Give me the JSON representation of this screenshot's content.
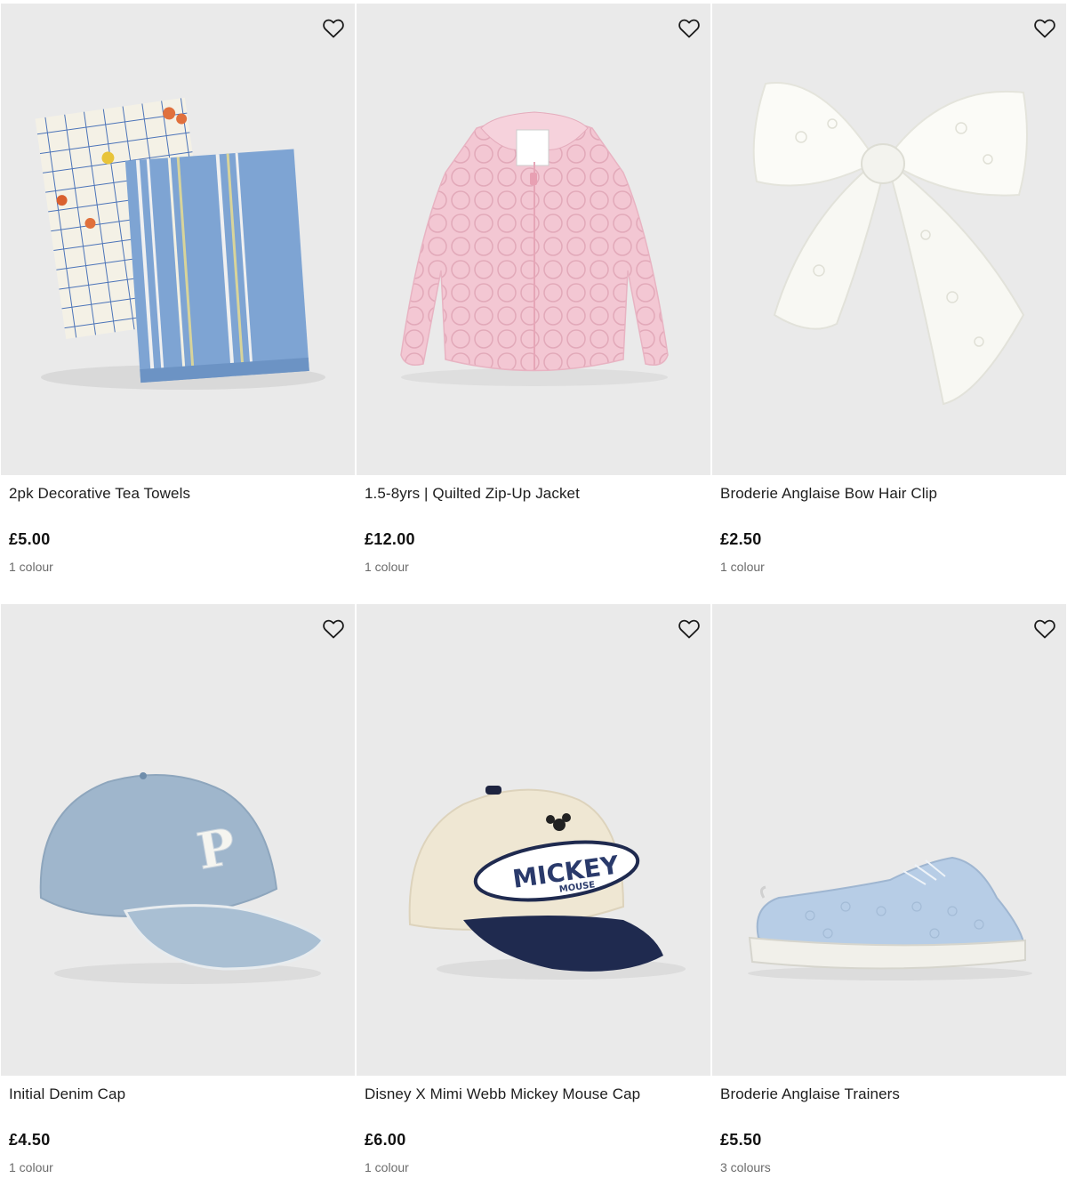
{
  "products": [
    {
      "name": "2pk Decorative Tea Towels",
      "price": "£5.00",
      "colours": "1 colour",
      "image": "tea-towels"
    },
    {
      "name": "1.5-8yrs | Quilted Zip-Up Jacket",
      "price": "£12.00",
      "colours": "1 colour",
      "image": "quilted-jacket"
    },
    {
      "name": "Broderie Anglaise Bow Hair Clip",
      "price": "£2.50",
      "colours": "1 colour",
      "image": "bow-hair-clip"
    },
    {
      "name": "Initial Denim Cap",
      "price": "£4.50",
      "colours": "1 colour",
      "image": "denim-cap"
    },
    {
      "name": "Disney X Mimi Webb Mickey Mouse Cap",
      "price": "£6.00",
      "colours": "1 colour",
      "image": "mickey-cap",
      "cap_text": "MICKEY",
      "cap_subtext": "MOUSE"
    },
    {
      "name": "Broderie Anglaise Trainers",
      "price": "£5.50",
      "colours": "3 colours",
      "image": "trainers"
    }
  ],
  "icons": {
    "favourite": "heart-outline-icon"
  },
  "colors": {
    "image_bg": "#eaeaea",
    "text": "#1d1d1d",
    "muted": "#6b6b6b"
  }
}
